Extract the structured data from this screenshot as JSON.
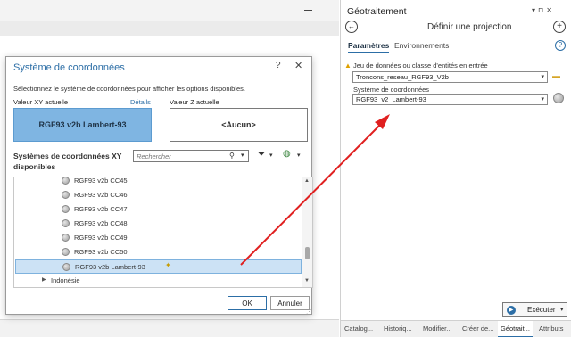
{
  "dialog": {
    "title": "Système de coordonnées",
    "help": "?",
    "close": "✕",
    "instructions": "Sélectionnez le système de coordonnées pour afficher les options disponibles.",
    "current_xy_label": "Valeur XY actuelle",
    "details_link": "Détails",
    "current_z_label": "Valeur Z actuelle",
    "current_xy_value": "RGF93 v2b Lambert-93",
    "current_z_value": "<Aucun>",
    "available_heading": "Systèmes de coordonnées XY disponibles",
    "search_placeholder": "Rechercher",
    "tree_items": [
      {
        "label": "RGF93 v2b CC45"
      },
      {
        "label": "RGF93 v2b CC46"
      },
      {
        "label": "RGF93 v2b CC47"
      },
      {
        "label": "RGF93 v2b CC48"
      },
      {
        "label": "RGF93 v2b CC49"
      },
      {
        "label": "RGF93 v2b CC50"
      },
      {
        "label": "RGF93 v2b Lambert-93",
        "selected": true
      }
    ],
    "tree_group": "Indonésie",
    "ok_label": "OK",
    "cancel_label": "Annuler"
  },
  "pane": {
    "title": "Géotraitement",
    "tool_name": "Définir une projection",
    "tabs": [
      "Paramètres",
      "Environnements"
    ],
    "input_label": "Jeu de données ou classe d'entités en entrée",
    "input_value": "Troncons_reseau_RGF93_V2b",
    "cs_label": "Système de coordonnées",
    "cs_value": "RGF93_v2_Lambert-93",
    "run_label": "Exécuter",
    "bottom_tabs": [
      "Catalog...",
      "Historiq...",
      "Modifier...",
      "Créer de...",
      "Géotrait...",
      "Attributs"
    ],
    "active_bottom_tab": "Géotrait..."
  },
  "icons": {
    "search": "search-icon",
    "filter": "filter-icon",
    "globe": "globe-icon",
    "folder": "folder-icon",
    "warning": "warning-icon",
    "play": "play-icon"
  },
  "colors": {
    "accent": "#2c6ea6",
    "selection": "#7fb5e2",
    "arrow": "#e02020"
  }
}
